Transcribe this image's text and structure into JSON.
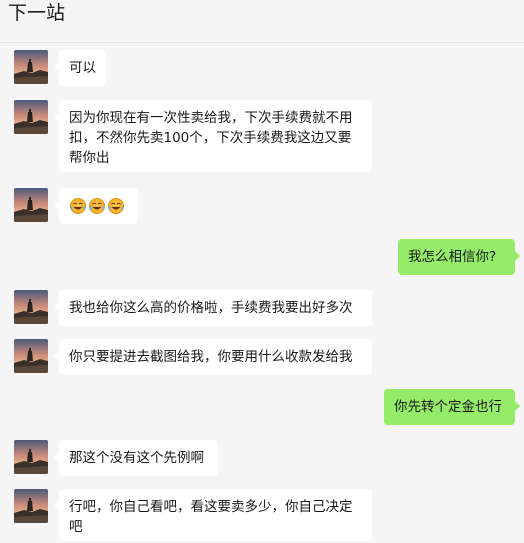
{
  "header": {
    "title": "下一站"
  },
  "messages": [
    {
      "side": "left",
      "text": "可以"
    },
    {
      "side": "left",
      "text": "因为你现在有一次性卖给我，下次手续费就不用扣，不然你先卖100个，下次手续费我这边又要帮你出"
    },
    {
      "side": "left",
      "emoji": [
        "laugh-cry-icon",
        "laugh-cry-icon",
        "laugh-cry-icon"
      ]
    },
    {
      "side": "right",
      "text": "我怎么相信你?"
    },
    {
      "side": "left",
      "text": "我也给你这么高的价格啦，手续费我要出好多次"
    },
    {
      "side": "left",
      "text": "你只要提进去截图给我，你要用什么收款发给我"
    },
    {
      "side": "right",
      "text": "你先转个定金也行"
    },
    {
      "side": "left",
      "text": "那这个没有这个先例啊"
    },
    {
      "side": "left",
      "text": "行吧，你自己看吧，看这要卖多少，你自己决定吧"
    }
  ],
  "colors": {
    "self_bubble": "#95ec69",
    "other_bubble": "#ffffff",
    "background": "#f5f5f5"
  }
}
